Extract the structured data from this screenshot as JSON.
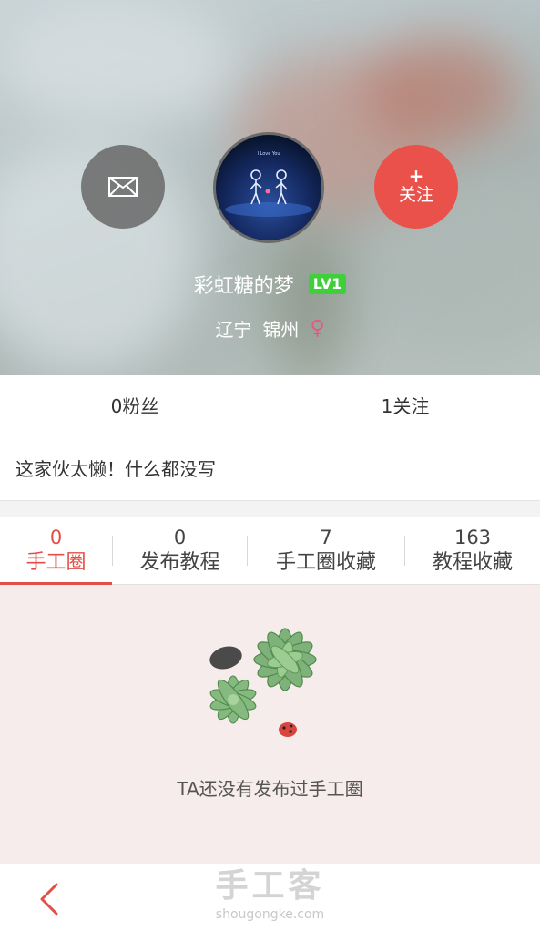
{
  "header": {
    "follow_plus": "+",
    "follow_label": "关注",
    "username": "彩虹糖的梦",
    "level": "LV1",
    "province": "辽宁",
    "city": "锦州",
    "gender_symbol": "♀",
    "avatar_caption": "I Love You",
    "colors": {
      "follow": "#e9514a",
      "level": "#3ecf3a",
      "gender": "#e8587f"
    }
  },
  "stats": {
    "fans": "0粉丝",
    "following": "1关注"
  },
  "bio": "这家伙太懒！什么都没写",
  "tabs": [
    {
      "count": "0",
      "label": "手工圈",
      "active": true
    },
    {
      "count": "0",
      "label": "发布教程",
      "active": false
    },
    {
      "count": "7",
      "label": "手工圈收藏",
      "active": false
    },
    {
      "count": "163",
      "label": "教程收藏",
      "active": false
    }
  ],
  "empty_state": {
    "message": "TA还没有发布过手工圈"
  },
  "watermark": {
    "brand": "手工客",
    "url": "shougongke.com"
  },
  "colors": {
    "accent": "#e14f47",
    "empty_bg": "#f5eceb"
  }
}
